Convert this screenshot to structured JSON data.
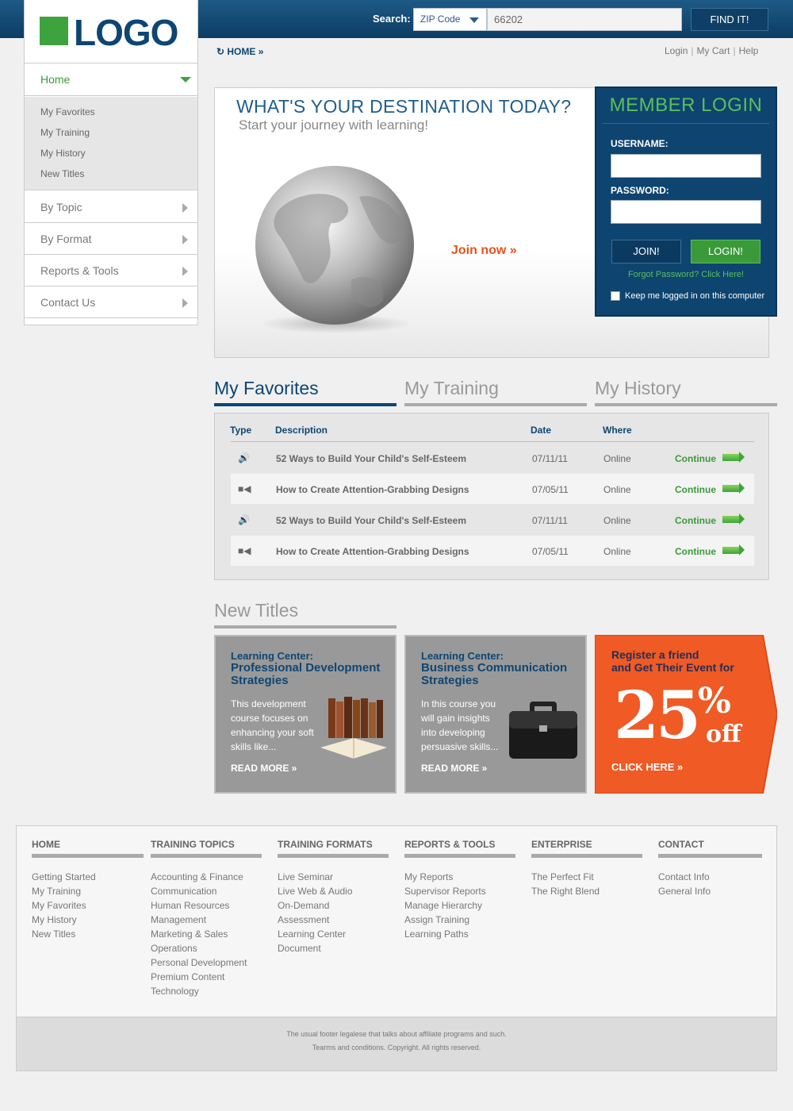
{
  "header": {
    "logo_text": "LOGO",
    "search_label": "Search:",
    "search_type": "ZIP Code",
    "search_value": "66202",
    "find_button": "FIND IT!"
  },
  "nav": {
    "home": "Home",
    "sub_items": [
      "My Favorites",
      "My Training",
      "My History",
      "New Titles"
    ],
    "items": [
      "By Topic",
      "By Format",
      "Reports & Tools",
      "Contact Us"
    ]
  },
  "breadcrumb": "HOME »",
  "top_links": [
    "Login",
    "My Cart",
    "Help"
  ],
  "hero": {
    "title": "WHAT'S YOUR DESTINATION TODAY?",
    "subtitle": "Start your journey with learning!",
    "join_now": "Join now »"
  },
  "login": {
    "title": "MEMBER LOGIN",
    "username_label": "USERNAME:",
    "password_label": "PASSWORD:",
    "join_button": "JOIN!",
    "login_button": "LOGIN!",
    "forgot": "Forgot Password? Click Here!",
    "keep_logged": "Keep me logged in on this computer"
  },
  "tabs": [
    "My Favorites",
    "My Training",
    "My History"
  ],
  "table": {
    "headers": [
      "Type",
      "Description",
      "Date",
      "Where"
    ],
    "rows": [
      {
        "type_icon": "speaker-icon",
        "description": "52 Ways to Build Your Child's Self-Esteem",
        "date": "07/11/11",
        "where": "Online",
        "action": "Continue"
      },
      {
        "type_icon": "video-icon",
        "description": "How to Create Attention-Grabbing Designs",
        "date": "07/05/11",
        "where": "Online",
        "action": "Continue"
      },
      {
        "type_icon": "speaker-icon",
        "description": "52 Ways to Build Your Child's Self-Esteem",
        "date": "07/11/11",
        "where": "Online",
        "action": "Continue"
      },
      {
        "type_icon": "video-icon",
        "description": "How to Create Attention-Grabbing Designs",
        "date": "07/05/11",
        "where": "Online",
        "action": "Continue"
      }
    ]
  },
  "new_titles": {
    "heading": "New Titles",
    "cards": [
      {
        "kicker": "Learning Center:",
        "title": "Professional Development Strategies",
        "body": "This development course focuses on enhancing your soft skills like...",
        "more": "READ MORE »",
        "image_icon": "books-icon"
      },
      {
        "kicker": "Learning Center:",
        "title": "Business Communication Strategies",
        "body": "In this course you will gain insights into developing persuasive skills...",
        "more": "READ MORE »",
        "image_icon": "briefcase-icon"
      }
    ],
    "promo": {
      "line1": "Register a friend",
      "line2": "and Get Their Event for",
      "percent": "25",
      "percent_sign": "%",
      "off": "off",
      "cta": "CLICK HERE »",
      "color": "#f05a24"
    }
  },
  "footer": {
    "columns": [
      {
        "heading": "HOME",
        "links": [
          "Getting Started",
          "My Training",
          "My Favorites",
          "My History",
          "New Titles"
        ]
      },
      {
        "heading": "TRAINING TOPICS",
        "links": [
          "Accounting & Finance",
          "Communication",
          "Human Resources",
          "Management",
          "Marketing & Sales",
          "Operations",
          "Personal Development",
          "Premium Content",
          "Technology"
        ]
      },
      {
        "heading": "TRAINING FORMATS",
        "links": [
          "Live Seminar",
          "Live Web & Audio",
          "On-Demand",
          "Assessment",
          "Learning Center",
          "Document"
        ]
      },
      {
        "heading": "REPORTS & TOOLS",
        "links": [
          "My Reports",
          "Supervisor Reports",
          "Manage Hierarchy",
          "Assign Training",
          "Learning Paths"
        ]
      },
      {
        "heading": "ENTERPRISE",
        "links": [
          "The Perfect Fit",
          "The Right Blend"
        ]
      },
      {
        "heading": "CONTACT",
        "links": [
          "Contact Info",
          "General Info"
        ]
      }
    ],
    "legal_line1": "The usual footer legalese that talks about affiliate programs and such.",
    "legal_line2": "Tearms and conditions. Copyright. All rights reserved."
  }
}
